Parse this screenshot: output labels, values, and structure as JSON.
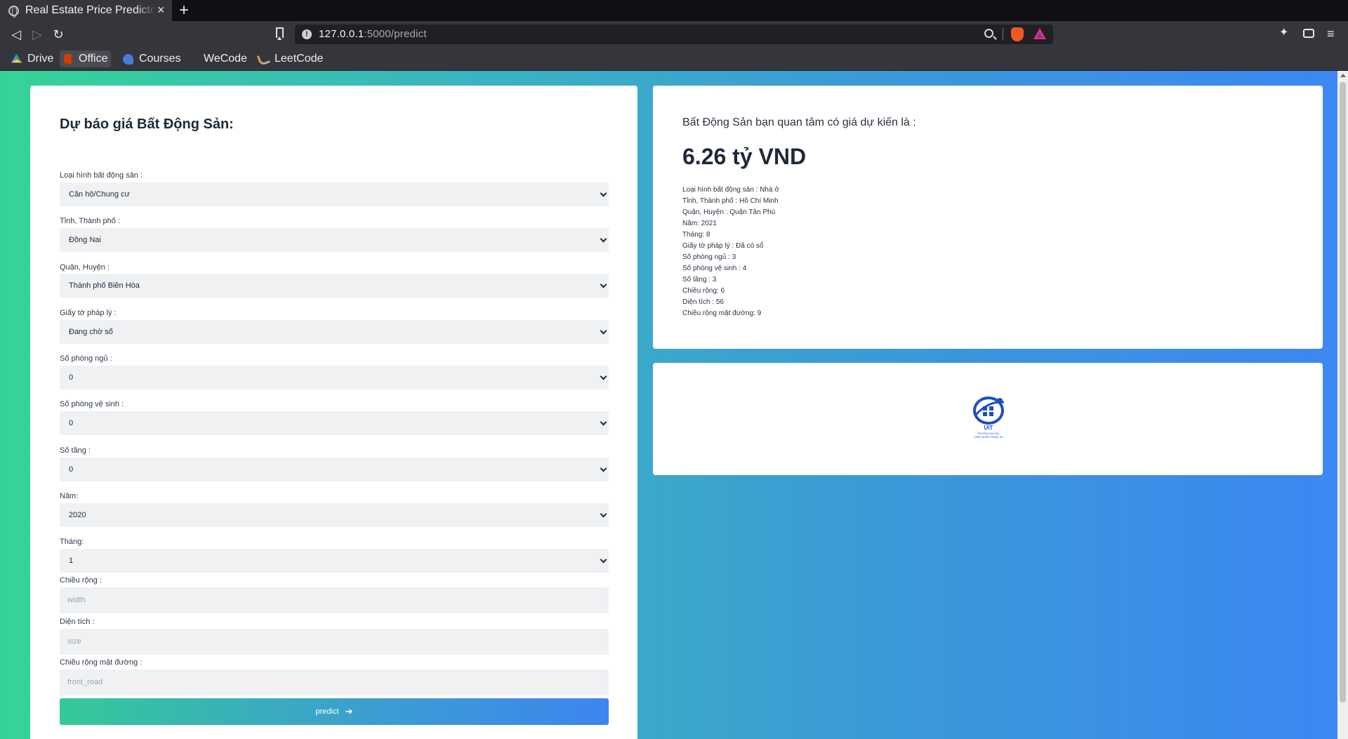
{
  "browser": {
    "tab_title": "Real Estate Price Predictor",
    "new_tab": "+",
    "url_host": "127.0.0.1",
    "url_rest": ":5000/predict",
    "bookmarks": [
      "Drive",
      "Office",
      "Courses",
      "WeCode",
      "LeetCode"
    ]
  },
  "form": {
    "title": "Dự báo giá Bất Động Sản:",
    "fields": [
      {
        "label": "Loại hình bất động sản :",
        "value": "Căn hộ/Chung cư"
      },
      {
        "label": "Tỉnh, Thành phố :",
        "value": "Đồng Nai"
      },
      {
        "label": "Quận, Huyện :",
        "value": "Thành phố Biên Hòa"
      },
      {
        "label": "Giấy tờ pháp lý :",
        "value": "Đang chờ sổ"
      },
      {
        "label": "Số phòng ngủ :",
        "value": "0"
      },
      {
        "label": "Số phòng vệ sinh :",
        "value": "0"
      },
      {
        "label": "Số tầng :",
        "value": "0"
      },
      {
        "label": "Năm:",
        "value": "2020"
      },
      {
        "label": "Tháng:",
        "value": "1"
      }
    ],
    "inputs": [
      {
        "label": "Chiều rộng :",
        "placeholder": "width"
      },
      {
        "label": "Diện tích :",
        "placeholder": "size"
      },
      {
        "label": "Chiều rộng mặt đường :",
        "placeholder": "front_road"
      }
    ],
    "submit_label": "predict",
    "submit_arrow": "➔"
  },
  "result": {
    "heading": "Bất Động Sản bạn quan tâm có giá dự kiến là :",
    "price": "6.26 tỷ VND",
    "details": [
      "Loại hình bất động sản : Nhà ở",
      "Tỉnh, Thành phố : Hồ Chí Minh",
      "Quận, Huyện : Quận Tân Phú",
      "Năm: 2021",
      "Tháng: 8",
      "Giấy tờ pháp lý : Đã có sổ",
      "Số phòng ngủ : 3",
      "Số phòng vệ sinh : 4",
      "Số tầng : 3",
      "Chiều rộng: 6",
      "Diện tích : 56",
      "Chiều rộng mặt đường: 9"
    ]
  },
  "logo": {
    "text": "UIT",
    "subtext_1": "TRƯỜNG ĐẠI HỌC",
    "subtext_2": "CÔNG NGHỆ THÔNG TIN",
    "color": "#1d4fbf"
  }
}
